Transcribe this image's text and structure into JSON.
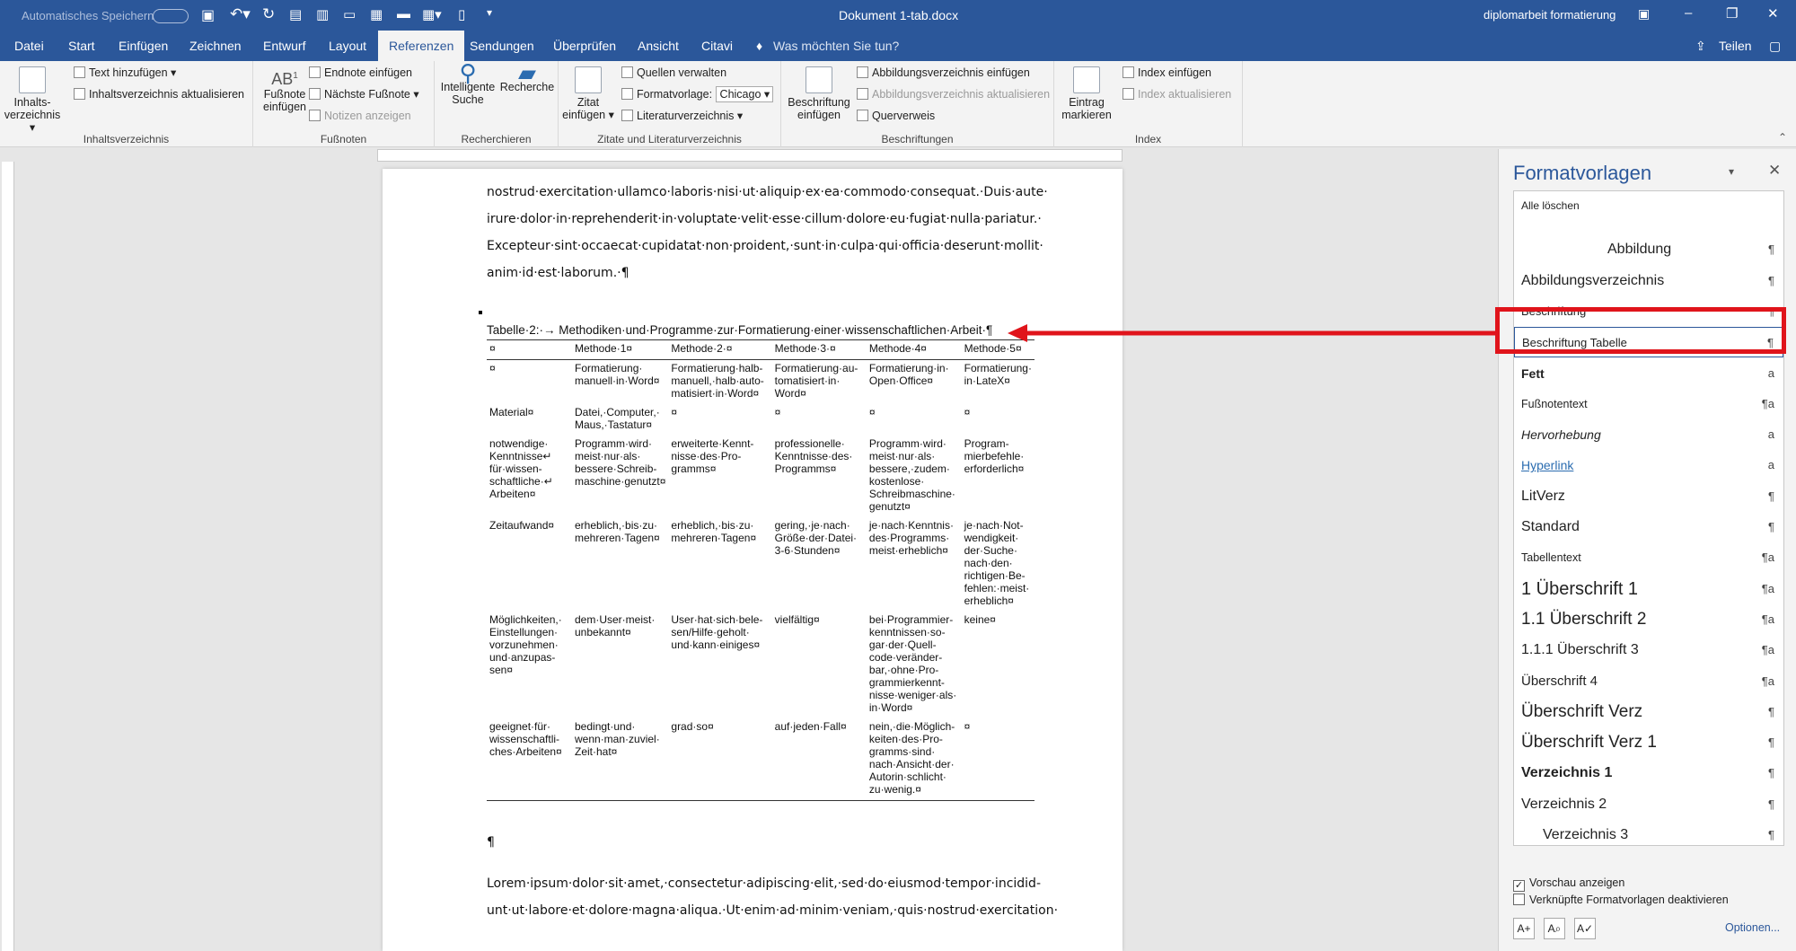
{
  "titlebar": {
    "autosave_label": "Automatisches Speichern",
    "doc_title": "Dokument 1-tab.docx",
    "account": "diplomarbeit formatierung"
  },
  "tabs": {
    "datei": "Datei",
    "start": "Start",
    "einfuegen": "Einfügen",
    "zeichnen": "Zeichnen",
    "entwurf": "Entwurf",
    "layout": "Layout",
    "referenzen": "Referenzen",
    "sendungen": "Sendungen",
    "ueberpruefen": "Überprüfen",
    "ansicht": "Ansicht",
    "citavi": "Citavi",
    "tellme": "Was möchten Sie tun?",
    "teilen": "Teilen"
  },
  "ribbon": {
    "inhalt": {
      "big": "Inhalts-",
      "big2": "verzeichnis",
      "text_hinzu": "Text hinzufügen",
      "aktualisieren": "Inhaltsverzeichnis aktualisieren",
      "label": "Inhaltsverzeichnis"
    },
    "fussnoten": {
      "big": "Fußnote",
      "big2": "einfügen",
      "endnote": "Endnote einfügen",
      "naechste": "Nächste Fußnote",
      "notizen": "Notizen anzeigen",
      "label": "Fußnoten"
    },
    "recherchieren": {
      "intel1": "Intelligente",
      "intel2": "Suche",
      "recherche": "Recherche",
      "label": "Recherchieren"
    },
    "zitate": {
      "zitat1": "Zitat",
      "zitat2": "einfügen",
      "quellen": "Quellen verwalten",
      "formatvorlage_label": "Formatvorlage:",
      "formatvorlage_value": "Chicago",
      "literatur": "Literaturverzeichnis",
      "label": "Zitate und Literaturverzeichnis"
    },
    "beschriftungen": {
      "big1": "Beschriftung",
      "big2": "einfügen",
      "abb_einf": "Abbildungsverzeichnis einfügen",
      "abb_akt": "Abbildungsverzeichnis aktualisieren",
      "querverweis": "Querverweis",
      "label": "Beschriftungen"
    },
    "index": {
      "big1": "Eintrag",
      "big2": "markieren",
      "einf": "Index einfügen",
      "akt": "Index aktualisieren",
      "label": "Index"
    }
  },
  "document": {
    "para1": [
      "nostrud·exercitation·ullamco·laboris·nisi·ut·aliquip·ex·ea·commodo·consequat.·Duis·aute·",
      "irure·dolor·in·reprehenderit·in·voluptate·velit·esse·cillum·dolore·eu·fugiat·nulla·pariatur.·",
      "Excepteur·sint·occaecat·cupidatat·non·proident,·sunt·in·culpa·qui·officia·deserunt·mollit·",
      "anim·id·est·laborum.·¶"
    ],
    "caption": "Tabelle·2:·→ Methodiken·und·Programme·zur·Formatierung·einer·wissenschaftlichen·Arbeit·¶",
    "table": {
      "headers": [
        "¤",
        "Methode·1¤",
        "Methode·2·¤",
        "Methode·3·¤",
        "Methode·4¤",
        "Methode·5¤"
      ],
      "rows": [
        [
          "¤",
          "Formatierung· manuell·in·Word¤",
          "Formatierung·halb- manuell,·halb·auto- matisiert·in·Word¤",
          "Formatierung·au- tomatisiert·in· Word¤",
          "Formatierung·in· Open·Office¤",
          "Formatierung· in·LateX¤"
        ],
        [
          "Material¤",
          "Datei,·Computer,· Maus,·Tastatur¤",
          "¤",
          "¤",
          "¤",
          "¤"
        ],
        [
          "notwendige· Kenntnisse↵ für·wissen- schaftliche·↵ Arbeiten¤",
          "Programm·wird· meist·nur·als· bessere·Schreib- maschine·genutzt¤",
          "erweiterte·Kennt- nisse·des·Pro- gramms¤",
          "professionelle· Kenntnisse·des· Programms¤",
          "Programm·wird· meist·nur·als· bessere,·zudem· kostenlose· Schreibmaschine· genutzt¤",
          "Program- mierbefehle· erforderlich¤"
        ],
        [
          "Zeitaufwand¤",
          "erheblich,·bis·zu· mehreren·Tagen¤",
          "erheblich,·bis·zu· mehreren·Tagen¤",
          "gering,·je·nach· Größe·der·Datei· 3-6·Stunden¤",
          "je·nach·Kenntnis· des·Programms· meist·erheblich¤",
          "je·nach·Not- wendigkeit· der·Suche· nach·den· richtigen·Be- fehlen:·meist· erheblich¤"
        ],
        [
          "Möglichkeiten,· Einstellungen· vorzunehmen· und·anzupas- sen¤",
          "dem·User·meist· unbekannt¤",
          "User·hat·sich·bele- sen/Hilfe·geholt· und·kann·einiges¤",
          "vielfältig¤",
          "bei·Programmier- kenntnissen·so- gar·der·Quell- code·veränder- bar,·ohne·Pro- grammierkennt- nisse·weniger·als· in·Word¤",
          "keine¤"
        ],
        [
          "geeignet·für· wissenschaftli- ches·Arbeiten¤",
          "bedingt·und· wenn·man·zuviel· Zeit·hat¤",
          "grad·so¤",
          "auf·jeden·Fall¤",
          "nein,·die·Möglich- keiten·des·Pro- gramms·sind· nach·Ansicht·der· Autorin·schlicht· zu·wenig.¤",
          "¤"
        ]
      ]
    },
    "pilcrow": "¶",
    "para2": [
      "Lorem·ipsum·dolor·sit·amet,·consectetur·adipiscing·elit,·sed·do·eiusmod·tempor·incidid-",
      "unt·ut·labore·et·dolore·magna·aliqua.·Ut·enim·ad·minim·veniam,·quis·nostrud·exercitation·"
    ]
  },
  "pane": {
    "title": "Formatvorlagen",
    "styles": [
      {
        "name": "Alle löschen",
        "mark": ""
      },
      {
        "name": "Abbildung",
        "mark": "¶"
      },
      {
        "name": "Abbildungsverzeichnis",
        "mark": "¶"
      },
      {
        "name": "Beschriftung",
        "mark": "¶"
      },
      {
        "name": "Beschriftung Tabelle",
        "mark": "¶"
      },
      {
        "name": "Fett",
        "mark": "a"
      },
      {
        "name": "Fußnotentext",
        "mark": "¶a"
      },
      {
        "name": "Hervorhebung",
        "mark": "a"
      },
      {
        "name": "Hyperlink",
        "mark": "a"
      },
      {
        "name": "LitVerz",
        "mark": "¶"
      },
      {
        "name": "Standard",
        "mark": "¶"
      },
      {
        "name": "Tabellentext",
        "mark": "¶a"
      },
      {
        "name": "1   Überschrift 1",
        "mark": "¶a"
      },
      {
        "name": "1.1   Überschrift 2",
        "mark": "¶a"
      },
      {
        "name": "1.1.1   Überschrift 3",
        "mark": "¶a"
      },
      {
        "name": "Überschrift 4",
        "mark": "¶a"
      },
      {
        "name": "Überschrift Verz",
        "mark": "¶"
      },
      {
        "name": "Überschrift Verz 1",
        "mark": "¶"
      },
      {
        "name": "Verzeichnis 1",
        "mark": "¶"
      },
      {
        "name": "Verzeichnis 2",
        "mark": "¶"
      },
      {
        "name": "Verzeichnis 3",
        "mark": "¶"
      }
    ],
    "vorschau": "Vorschau anzeigen",
    "verknuepfte": "Verknüpfte Formatvorlagen deaktivieren",
    "optionen": "Optionen...",
    "highlight_color": "#e0141b"
  }
}
